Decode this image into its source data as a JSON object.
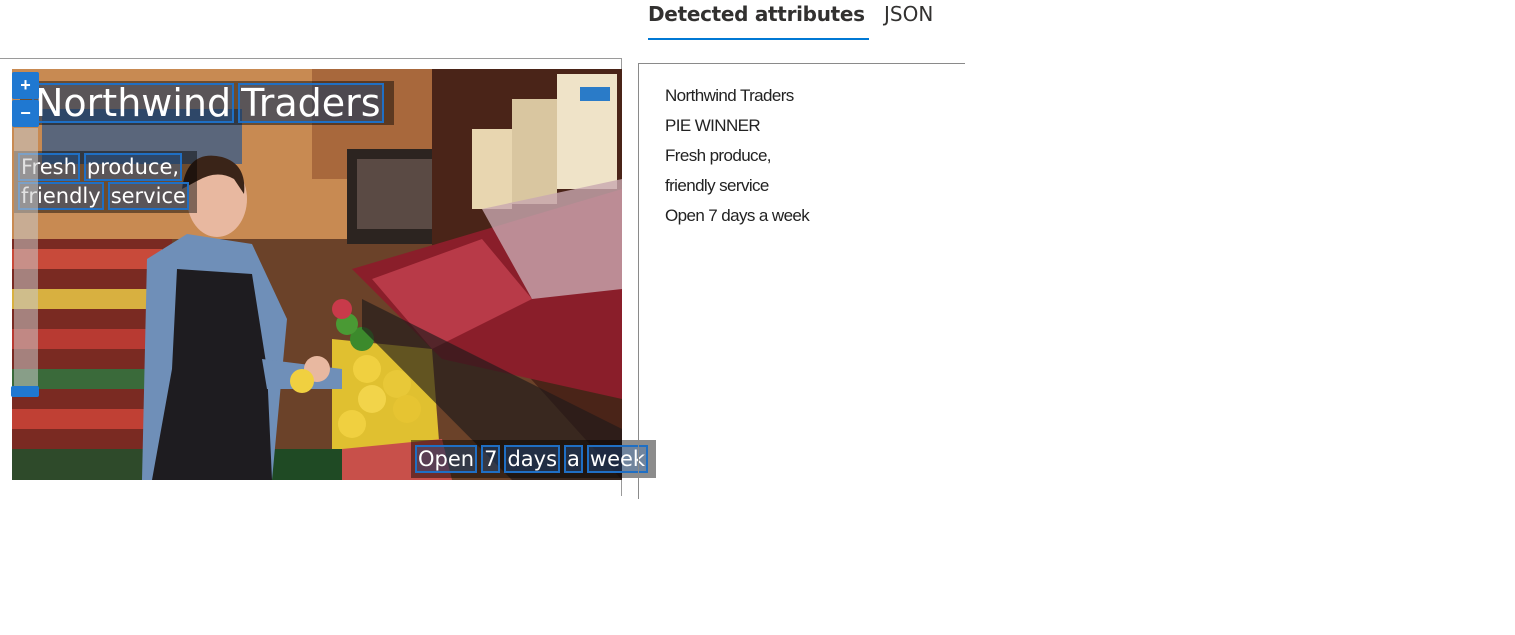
{
  "tabs": [
    {
      "label": "Detected attributes",
      "active": true
    },
    {
      "label": "JSON",
      "active": false
    }
  ],
  "viewer": {
    "zoom_in_label": "+",
    "zoom_out_label": "−",
    "ocr_overlays": {
      "title_words": [
        "Northwind",
        "Traders"
      ],
      "subtitle_line1": [
        "Fresh",
        "produce,"
      ],
      "subtitle_line2": [
        "friendly",
        "service"
      ],
      "bottom_words": [
        "Open",
        "7",
        "days",
        "a",
        "week"
      ]
    }
  },
  "attributes": [
    "Northwind Traders",
    "PIE WINNER",
    "Fresh produce,",
    "friendly service",
    "Open 7 days a week"
  ],
  "colors": {
    "accent": "#0078d4",
    "box": "#1f6fc4"
  }
}
